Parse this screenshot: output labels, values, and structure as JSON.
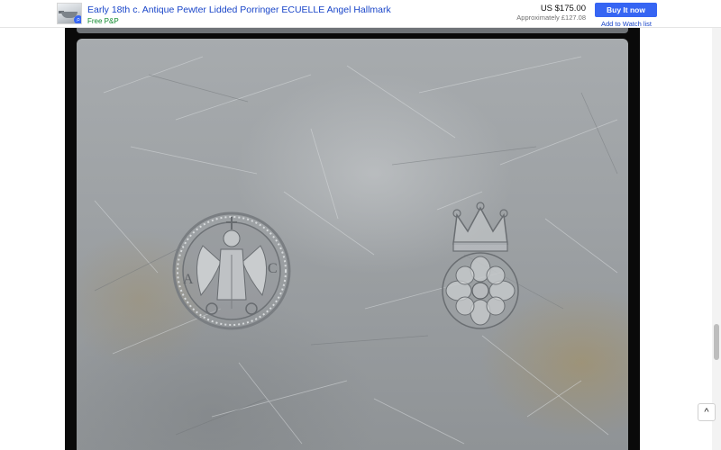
{
  "header": {
    "title": "Early 18th c. Antique Pewter Lidded Porringer ECUELLE Angel Hallmark",
    "shipping": "Free P&P",
    "price": "US $175.00",
    "approx_price": "Approximately £127.08",
    "buy_label": "Buy It now",
    "watch_label": "Add to Watch list"
  },
  "icons": {
    "thumbnail_zoom": "magnifier-icon",
    "back_to_top": "chevron-up-icon"
  },
  "colors": {
    "link_blue": "#1a46c9",
    "button_blue": "#3665f3",
    "shipping_green": "#0f8a2e",
    "viewer_bg": "#0a0a0a"
  },
  "viewer": {
    "left_hallmark_letters": [
      "A",
      "C"
    ]
  }
}
